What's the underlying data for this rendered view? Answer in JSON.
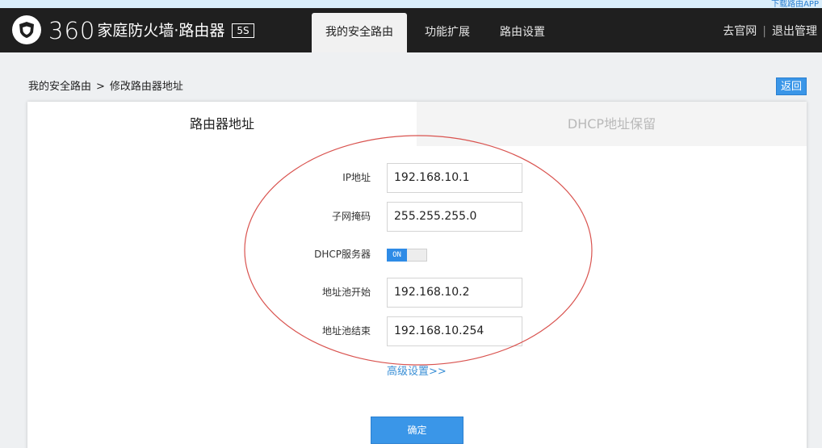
{
  "header": {
    "brand_number": "360",
    "brand_name": "家庭防火墙·路由器",
    "model_badge": "5S",
    "tabs": [
      {
        "label": "我的安全路由",
        "active": true
      },
      {
        "label": "功能扩展",
        "active": false
      },
      {
        "label": "路由设置",
        "active": false
      }
    ],
    "links": {
      "website": "去官网",
      "separator": "|",
      "logout": "退出管理"
    }
  },
  "topstrip_text": "下载路由APP",
  "breadcrumb": {
    "root": "我的安全路由",
    "separator": ">",
    "current": "修改路由器地址"
  },
  "back_button": "返回",
  "card": {
    "tabs": [
      {
        "label": "路由器地址",
        "active": true
      },
      {
        "label": "DHCP地址保留",
        "active": false
      }
    ],
    "form": {
      "ip_label": "IP地址",
      "ip_value": "192.168.10.1",
      "mask_label": "子网掩码",
      "mask_value": "255.255.255.0",
      "dhcp_label": "DHCP服务器",
      "dhcp_state": "ON",
      "pool_start_label": "地址池开始",
      "pool_start_value": "192.168.10.2",
      "pool_end_label": "地址池结束",
      "pool_end_value": "192.168.10.254"
    },
    "advanced_link": "高级设置>>",
    "confirm_button": "确定"
  },
  "colors": {
    "header_bg": "#1f1f1f",
    "accent_blue": "#3a96e8",
    "annotation_red": "#d9534f"
  },
  "icons": {
    "logo": "shield-icon"
  }
}
